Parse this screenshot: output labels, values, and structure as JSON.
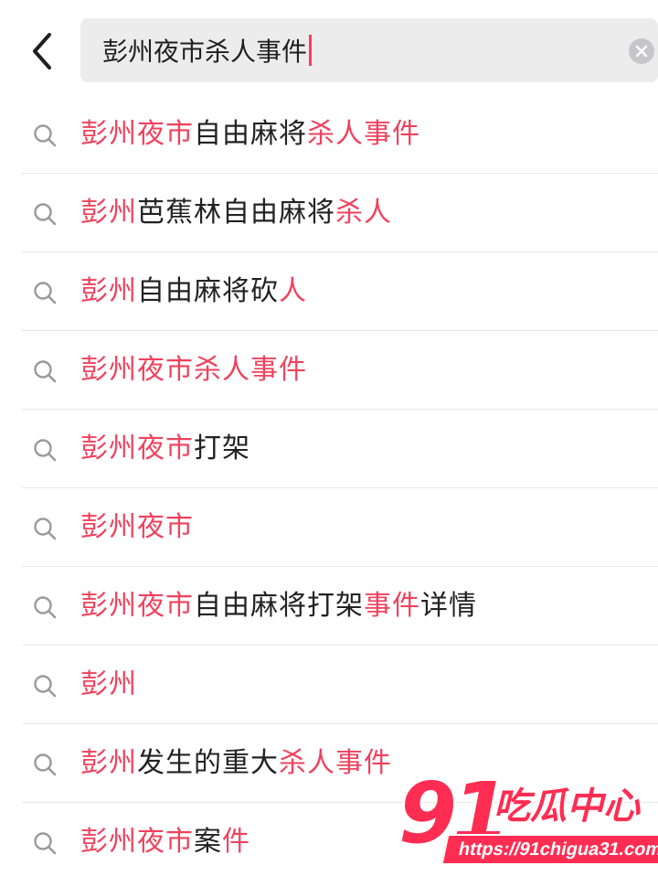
{
  "search": {
    "query": "彭州夜市杀人事件"
  },
  "icons": {
    "back": "chevron-left-icon",
    "clear": "clear-circle-icon",
    "row": "search-icon"
  },
  "colors": {
    "highlight": "#f0425e",
    "text": "#222222",
    "search_bg": "#ececed",
    "cursor": "#ff3b5c"
  },
  "suggestions": [
    {
      "segments": [
        {
          "text": "彭州夜市",
          "hl": true
        },
        {
          "text": "自由麻将",
          "hl": false
        },
        {
          "text": "杀人事件",
          "hl": true
        }
      ]
    },
    {
      "segments": [
        {
          "text": "彭州",
          "hl": true
        },
        {
          "text": "芭蕉林自由麻将",
          "hl": false
        },
        {
          "text": "杀人",
          "hl": true
        }
      ]
    },
    {
      "segments": [
        {
          "text": "彭州",
          "hl": true
        },
        {
          "text": "自由麻将砍",
          "hl": false
        },
        {
          "text": "人",
          "hl": true
        }
      ]
    },
    {
      "segments": [
        {
          "text": "彭州夜市杀人事件",
          "hl": true
        }
      ]
    },
    {
      "segments": [
        {
          "text": "彭州夜市",
          "hl": true
        },
        {
          "text": "打架",
          "hl": false
        }
      ]
    },
    {
      "segments": [
        {
          "text": "彭州夜市",
          "hl": true
        }
      ]
    },
    {
      "segments": [
        {
          "text": "彭州夜市",
          "hl": true
        },
        {
          "text": "自由麻将打架",
          "hl": false
        },
        {
          "text": "事件",
          "hl": true
        },
        {
          "text": "详情",
          "hl": false
        }
      ]
    },
    {
      "segments": [
        {
          "text": "彭州",
          "hl": true
        }
      ]
    },
    {
      "segments": [
        {
          "text": "彭州",
          "hl": true
        },
        {
          "text": "发生的重大",
          "hl": false
        },
        {
          "text": "杀人事件",
          "hl": true
        }
      ]
    },
    {
      "segments": [
        {
          "text": "彭州夜市",
          "hl": true
        },
        {
          "text": "案",
          "hl": false
        },
        {
          "text": "件",
          "hl": true
        }
      ]
    }
  ],
  "watermark": {
    "number": "91",
    "title": "吃瓜中心",
    "url": "https://91chigua31.com"
  }
}
